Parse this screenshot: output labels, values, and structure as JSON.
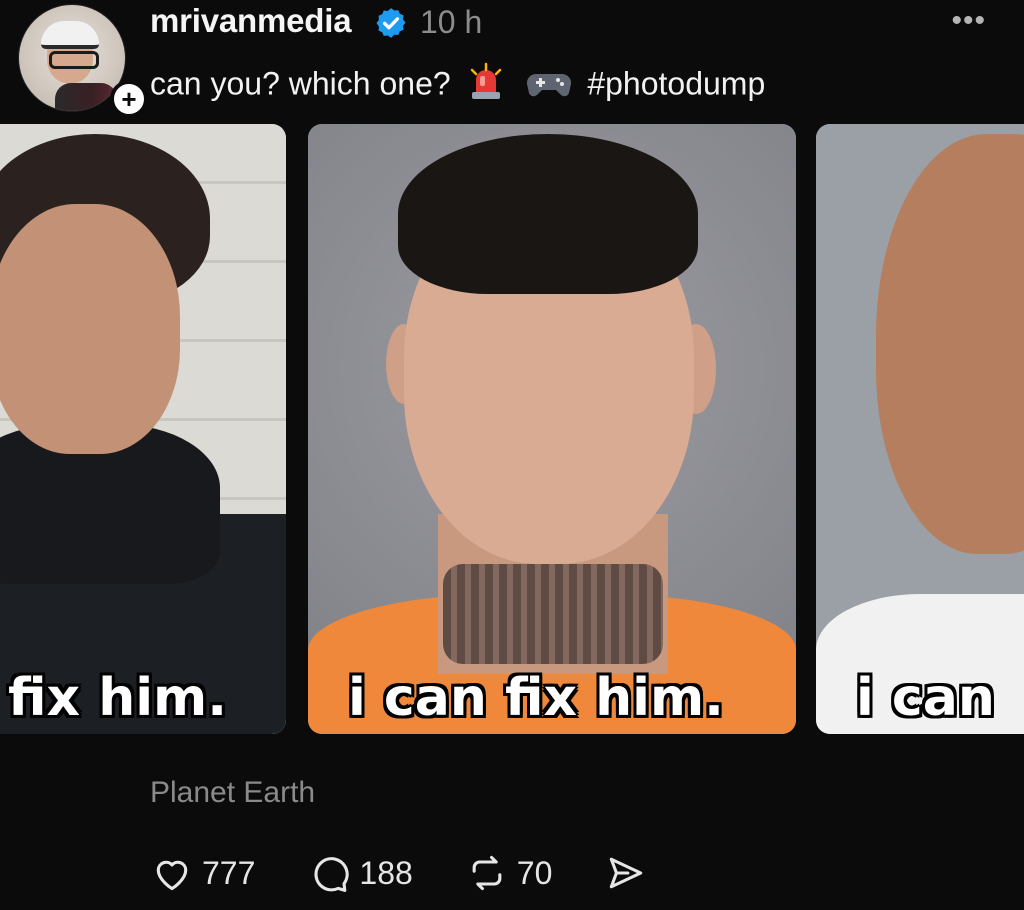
{
  "post": {
    "username": "mrivanmedia",
    "time": "10 h",
    "caption_text": "can you? which one?",
    "caption_hashtag": "#photodump",
    "caption_emojis": [
      "police-light-emoji",
      "gamepad-emoji"
    ],
    "follow_label": "+",
    "more_label": "•••",
    "location": "Planet Earth"
  },
  "carousel": {
    "cards": [
      {
        "text": "fix him."
      },
      {
        "text": "i can fix him."
      },
      {
        "text": "i can"
      }
    ]
  },
  "actions": {
    "likes": "777",
    "comments": "188",
    "reposts": "70"
  },
  "colors": {
    "background": "#0b0b0c",
    "verified": "#1d9bf0",
    "muted": "#8c8c8c"
  }
}
